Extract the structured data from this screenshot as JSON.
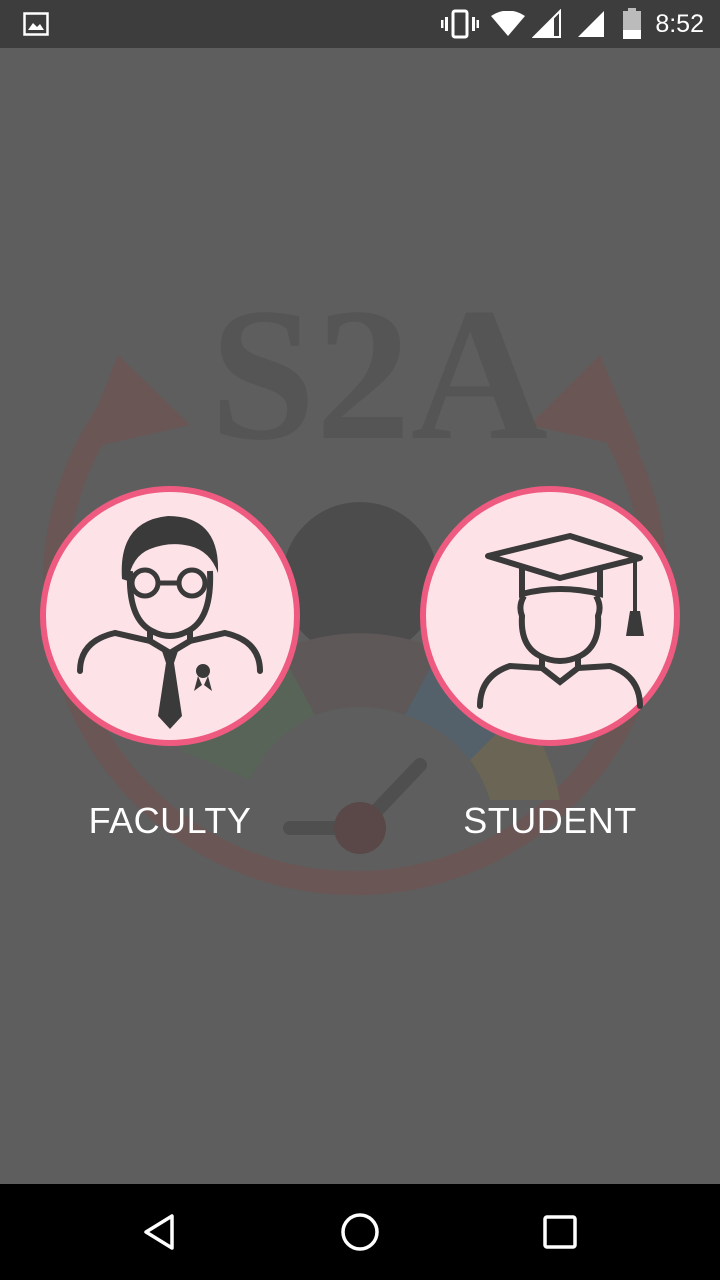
{
  "status_bar": {
    "time": "8:52",
    "icons": [
      "image-notification-icon",
      "vibrate-icon",
      "wifi-icon",
      "signal-icon",
      "signal-icon",
      "battery-icon"
    ]
  },
  "watermark": {
    "logo_text": "S2A"
  },
  "roles": [
    {
      "label": "FACULTY",
      "icon": "faculty-icon"
    },
    {
      "label": "STUDENT",
      "icon": "student-graduate-icon"
    }
  ],
  "nav_bar": {
    "buttons": [
      "back-icon",
      "home-icon",
      "recents-icon"
    ]
  },
  "colors": {
    "background": "#5e5e5e",
    "status_bar": "#3d3d3d",
    "circle_fill": "#fde3e8",
    "circle_border": "#ef5b80",
    "icon_stroke": "#3a3a3a",
    "nav_bar": "#000000"
  }
}
